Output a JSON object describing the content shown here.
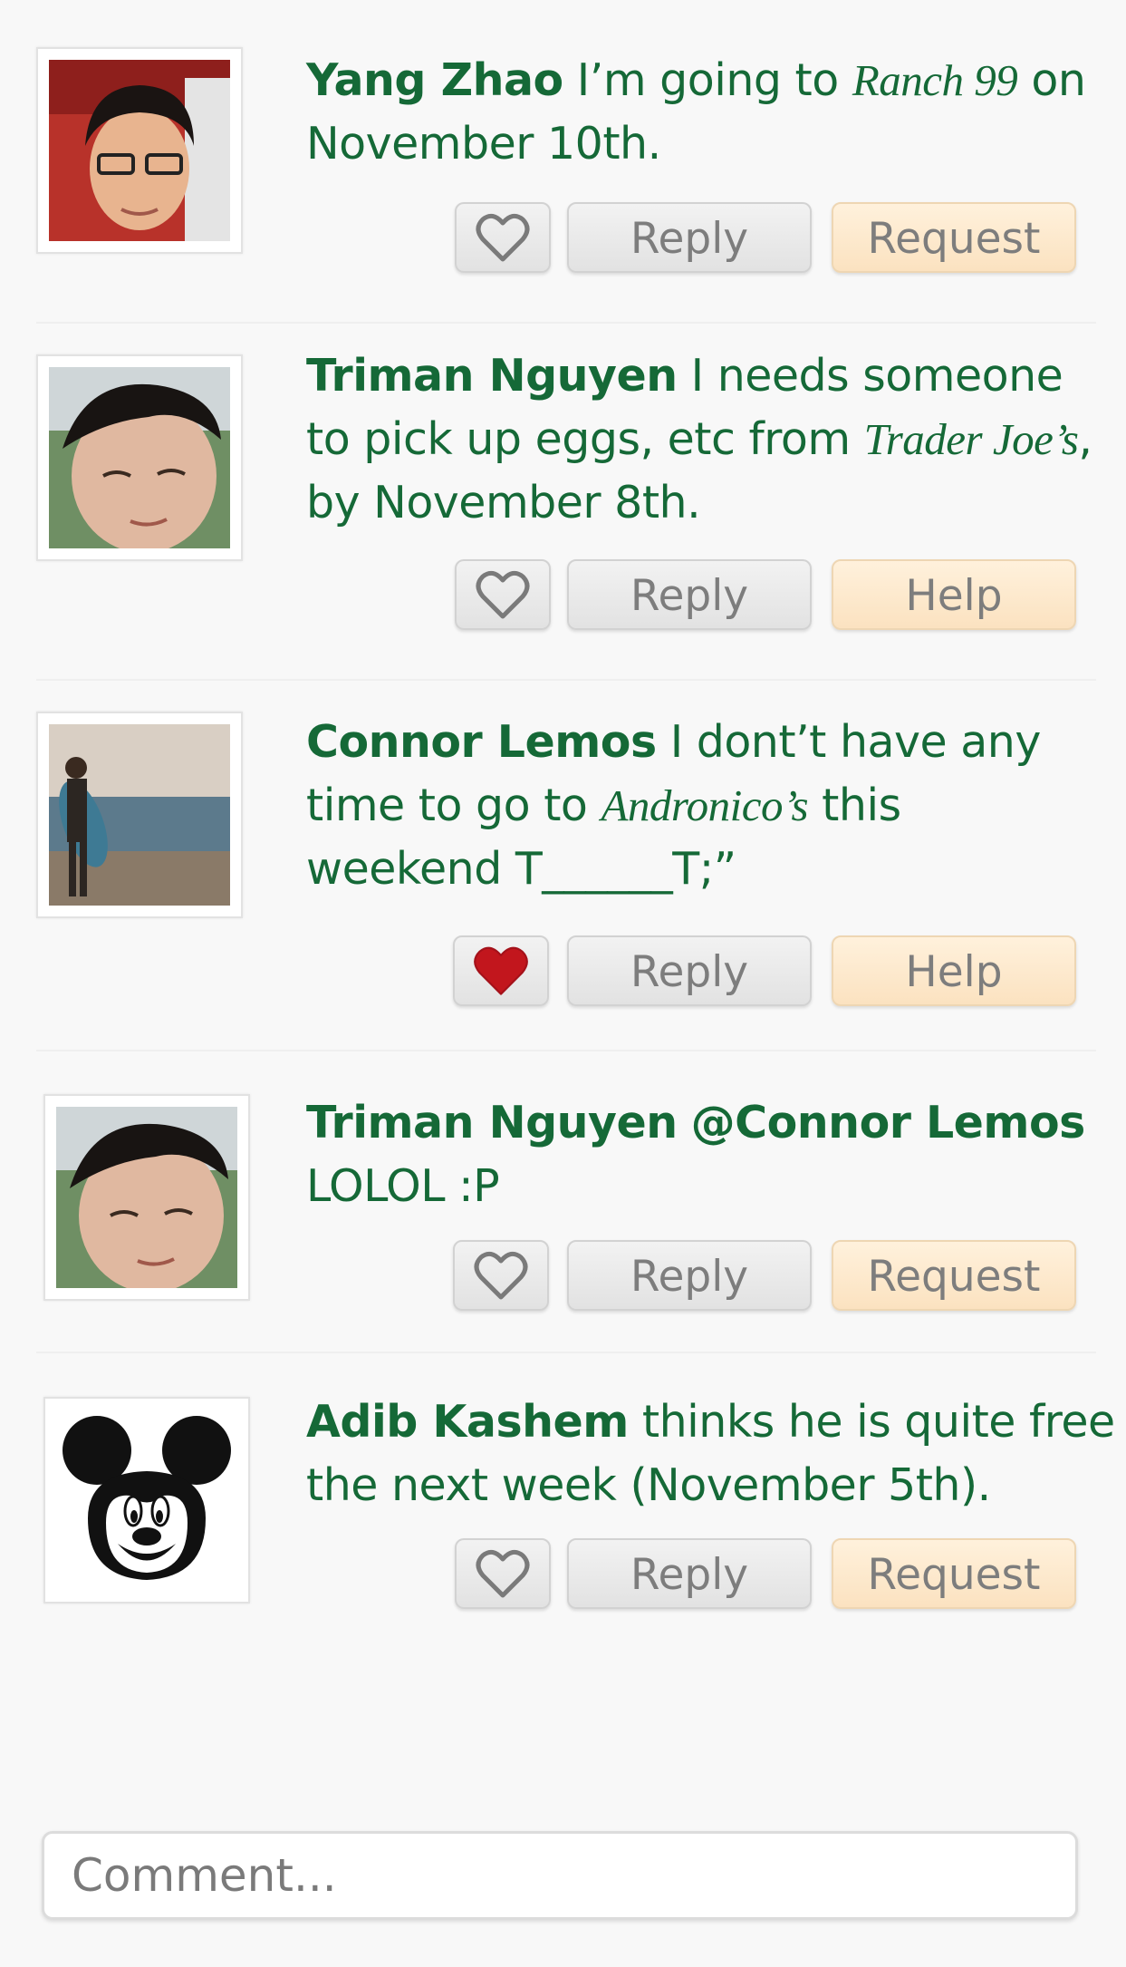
{
  "posts": [
    {
      "name": "Yang Zhao",
      "segments": [
        " I’m going to ",
        "Ranch 99",
        " on November 10th."
      ],
      "liked": false,
      "reply_label": "Reply",
      "action_label": "Request"
    },
    {
      "name": "Triman Nguyen",
      "segments": [
        " I needs someone to pick up eggs, etc from ",
        "Trader Joe’s",
        ", by November 8th."
      ],
      "liked": false,
      "reply_label": "Reply",
      "action_label": "Help"
    },
    {
      "name": "Connor Lemos",
      "segments": [
        " I dont’t have any time to go to ",
        "Andronico’s",
        " this weekend T______T;”"
      ],
      "liked": true,
      "reply_label": "Reply",
      "action_label": "Help"
    },
    {
      "name": "Triman Nguyen",
      "mention": "@Connor Lemos",
      "body": "LOLOL :P",
      "liked": false,
      "reply_label": "Reply",
      "action_label": "Request"
    },
    {
      "name": "Adib Kashem",
      "body": " thinks he is quite free the next week (November 5th).",
      "liked": false,
      "reply_label": "Reply",
      "action_label": "Request"
    }
  ],
  "comment": {
    "placeholder": "Comment..."
  },
  "colors": {
    "text": "#156937",
    "heart": "#c2161d",
    "action_button": "#fbe5c6"
  },
  "icons": {
    "like": "heart-icon"
  }
}
